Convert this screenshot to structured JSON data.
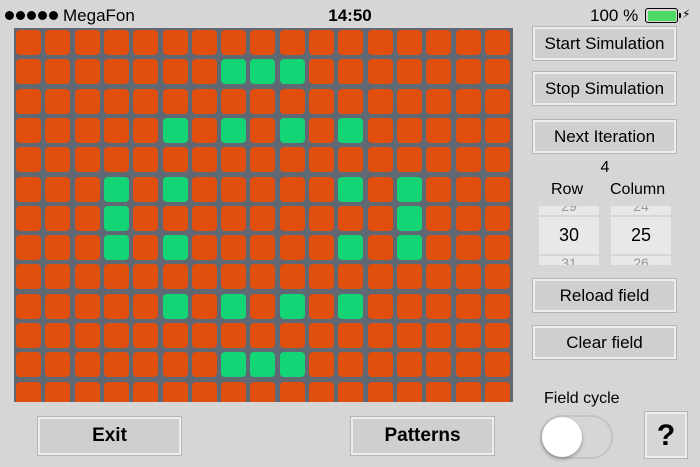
{
  "status_bar": {
    "carrier": "MegaFon",
    "time": "14:50",
    "battery_percent": "100 %",
    "battery_level": 1.0
  },
  "colors": {
    "dead_cell": "#e14f0e",
    "alive_cell": "#14d575",
    "grid_background": "#5f6873",
    "app_background": "#d6d6d6"
  },
  "grid": {
    "rows": 13,
    "columns": 17,
    "alive_cells": [
      [
        1,
        7
      ],
      [
        1,
        8
      ],
      [
        1,
        9
      ],
      [
        3,
        5
      ],
      [
        3,
        7
      ],
      [
        3,
        9
      ],
      [
        3,
        11
      ],
      [
        5,
        3
      ],
      [
        5,
        5
      ],
      [
        5,
        11
      ],
      [
        5,
        13
      ],
      [
        6,
        3
      ],
      [
        6,
        13
      ],
      [
        7,
        3
      ],
      [
        7,
        5
      ],
      [
        7,
        11
      ],
      [
        7,
        13
      ],
      [
        9,
        5
      ],
      [
        9,
        7
      ],
      [
        9,
        9
      ],
      [
        9,
        11
      ],
      [
        11,
        7
      ],
      [
        11,
        8
      ],
      [
        11,
        9
      ]
    ]
  },
  "controls": {
    "start_label": "Start Simulation",
    "stop_label": "Stop Simulation",
    "next_label": "Next Iteration",
    "iteration_count": "4",
    "row_label": "Row",
    "column_label": "Column",
    "row_value": "30",
    "column_value": "25",
    "row_prev": "29",
    "row_next": "31",
    "column_prev": "24",
    "column_next": "26",
    "reload_label": "Reload field",
    "clear_label": "Clear field"
  },
  "bottom": {
    "exit_label": "Exit",
    "patterns_label": "Patterns",
    "field_cycle_label": "Field cycle",
    "field_cycle_on": false,
    "help_label": "?"
  }
}
